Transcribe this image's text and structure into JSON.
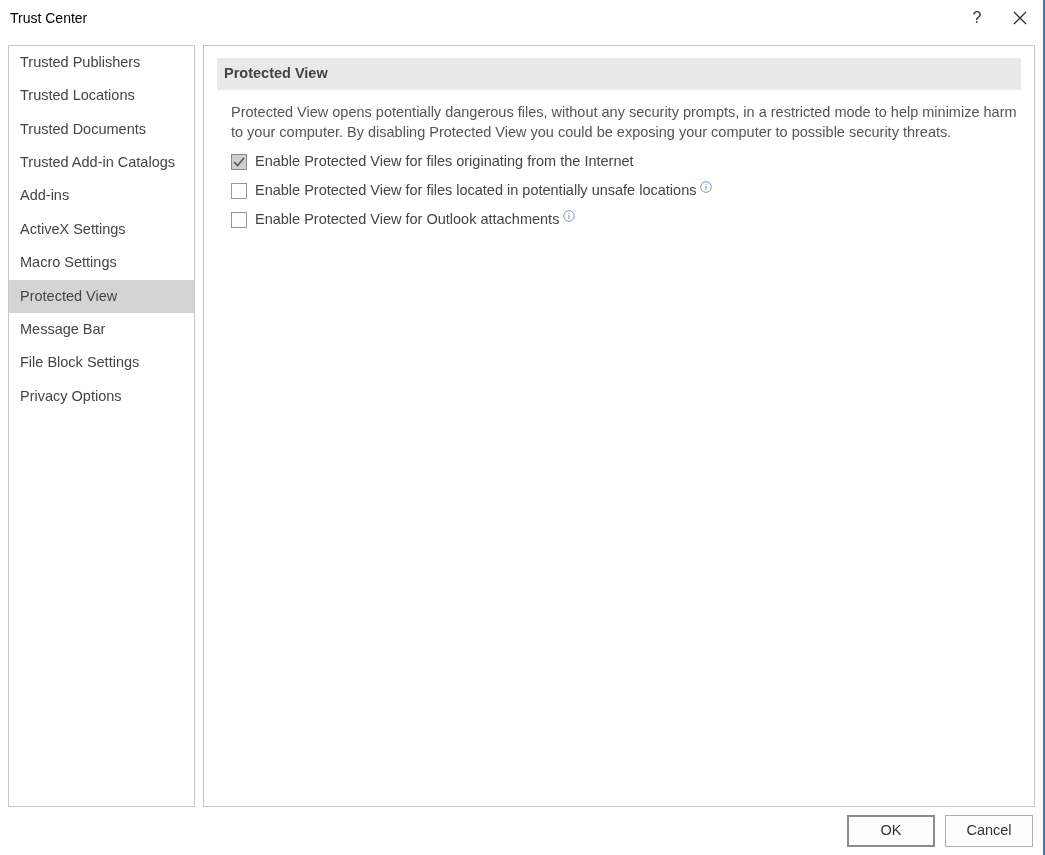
{
  "window": {
    "title": "Trust Center",
    "help": "?"
  },
  "sidebar": {
    "items": [
      {
        "label": "Trusted Publishers",
        "selected": false
      },
      {
        "label": "Trusted Locations",
        "selected": false
      },
      {
        "label": "Trusted Documents",
        "selected": false
      },
      {
        "label": "Trusted Add-in Catalogs",
        "selected": false
      },
      {
        "label": "Add-ins",
        "selected": false
      },
      {
        "label": "ActiveX Settings",
        "selected": false
      },
      {
        "label": "Macro Settings",
        "selected": false
      },
      {
        "label": "Protected View",
        "selected": true
      },
      {
        "label": "Message Bar",
        "selected": false
      },
      {
        "label": "File Block Settings",
        "selected": false
      },
      {
        "label": "Privacy Options",
        "selected": false
      }
    ]
  },
  "section": {
    "heading": "Protected View",
    "description": "Protected View opens potentially dangerous files, without any security prompts, in a restricted mode to help minimize harm to your computer. By disabling Protected View you could be exposing your computer to possible security threats.",
    "options": [
      {
        "label": "Enable Protected View for files originating from the Internet",
        "checked": true,
        "info": false
      },
      {
        "label": "Enable Protected View for files located in potentially unsafe locations",
        "checked": false,
        "info": true
      },
      {
        "label": "Enable Protected View for Outlook attachments",
        "checked": false,
        "info": true
      }
    ]
  },
  "buttons": [
    "OK",
    "Cancel"
  ]
}
